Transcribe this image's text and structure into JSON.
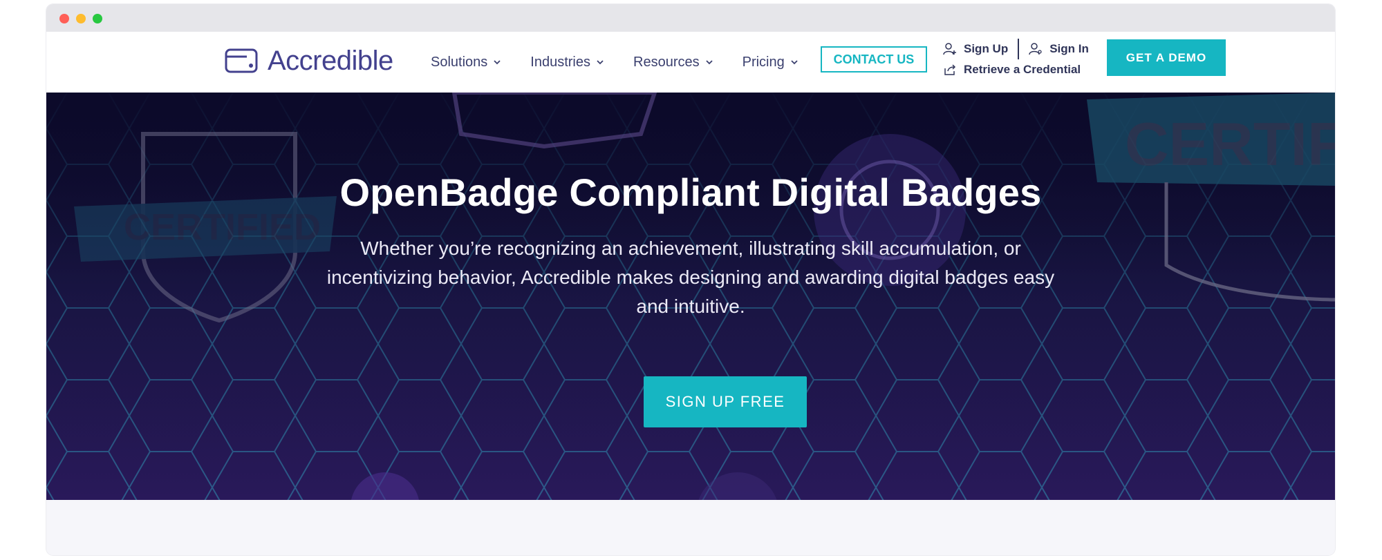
{
  "brand": {
    "name": "Accredible",
    "accent_color": "#16b6c2",
    "logo_color": "#43418e"
  },
  "nav": {
    "items": [
      {
        "label": "Solutions"
      },
      {
        "label": "Industries"
      },
      {
        "label": "Resources"
      },
      {
        "label": "Pricing"
      }
    ],
    "contact_label": "CONTACT US",
    "sign_up_label": "Sign Up",
    "sign_in_label": "Sign In",
    "retrieve_label": "Retrieve a Credential",
    "demo_label": "GET A DEMO"
  },
  "hero": {
    "title": "OpenBadge Compliant Digital Badges",
    "subtitle": "Whether you’re recognizing an achievement, illustrating skill accumulation, or incentivizing behavior, Accredible makes designing and awarding digital badges easy and intuitive.",
    "cta_label": "SIGN UP FREE",
    "bg_badge_text_left": "CERTIFIED",
    "bg_badge_text_right": "CERTIF"
  }
}
